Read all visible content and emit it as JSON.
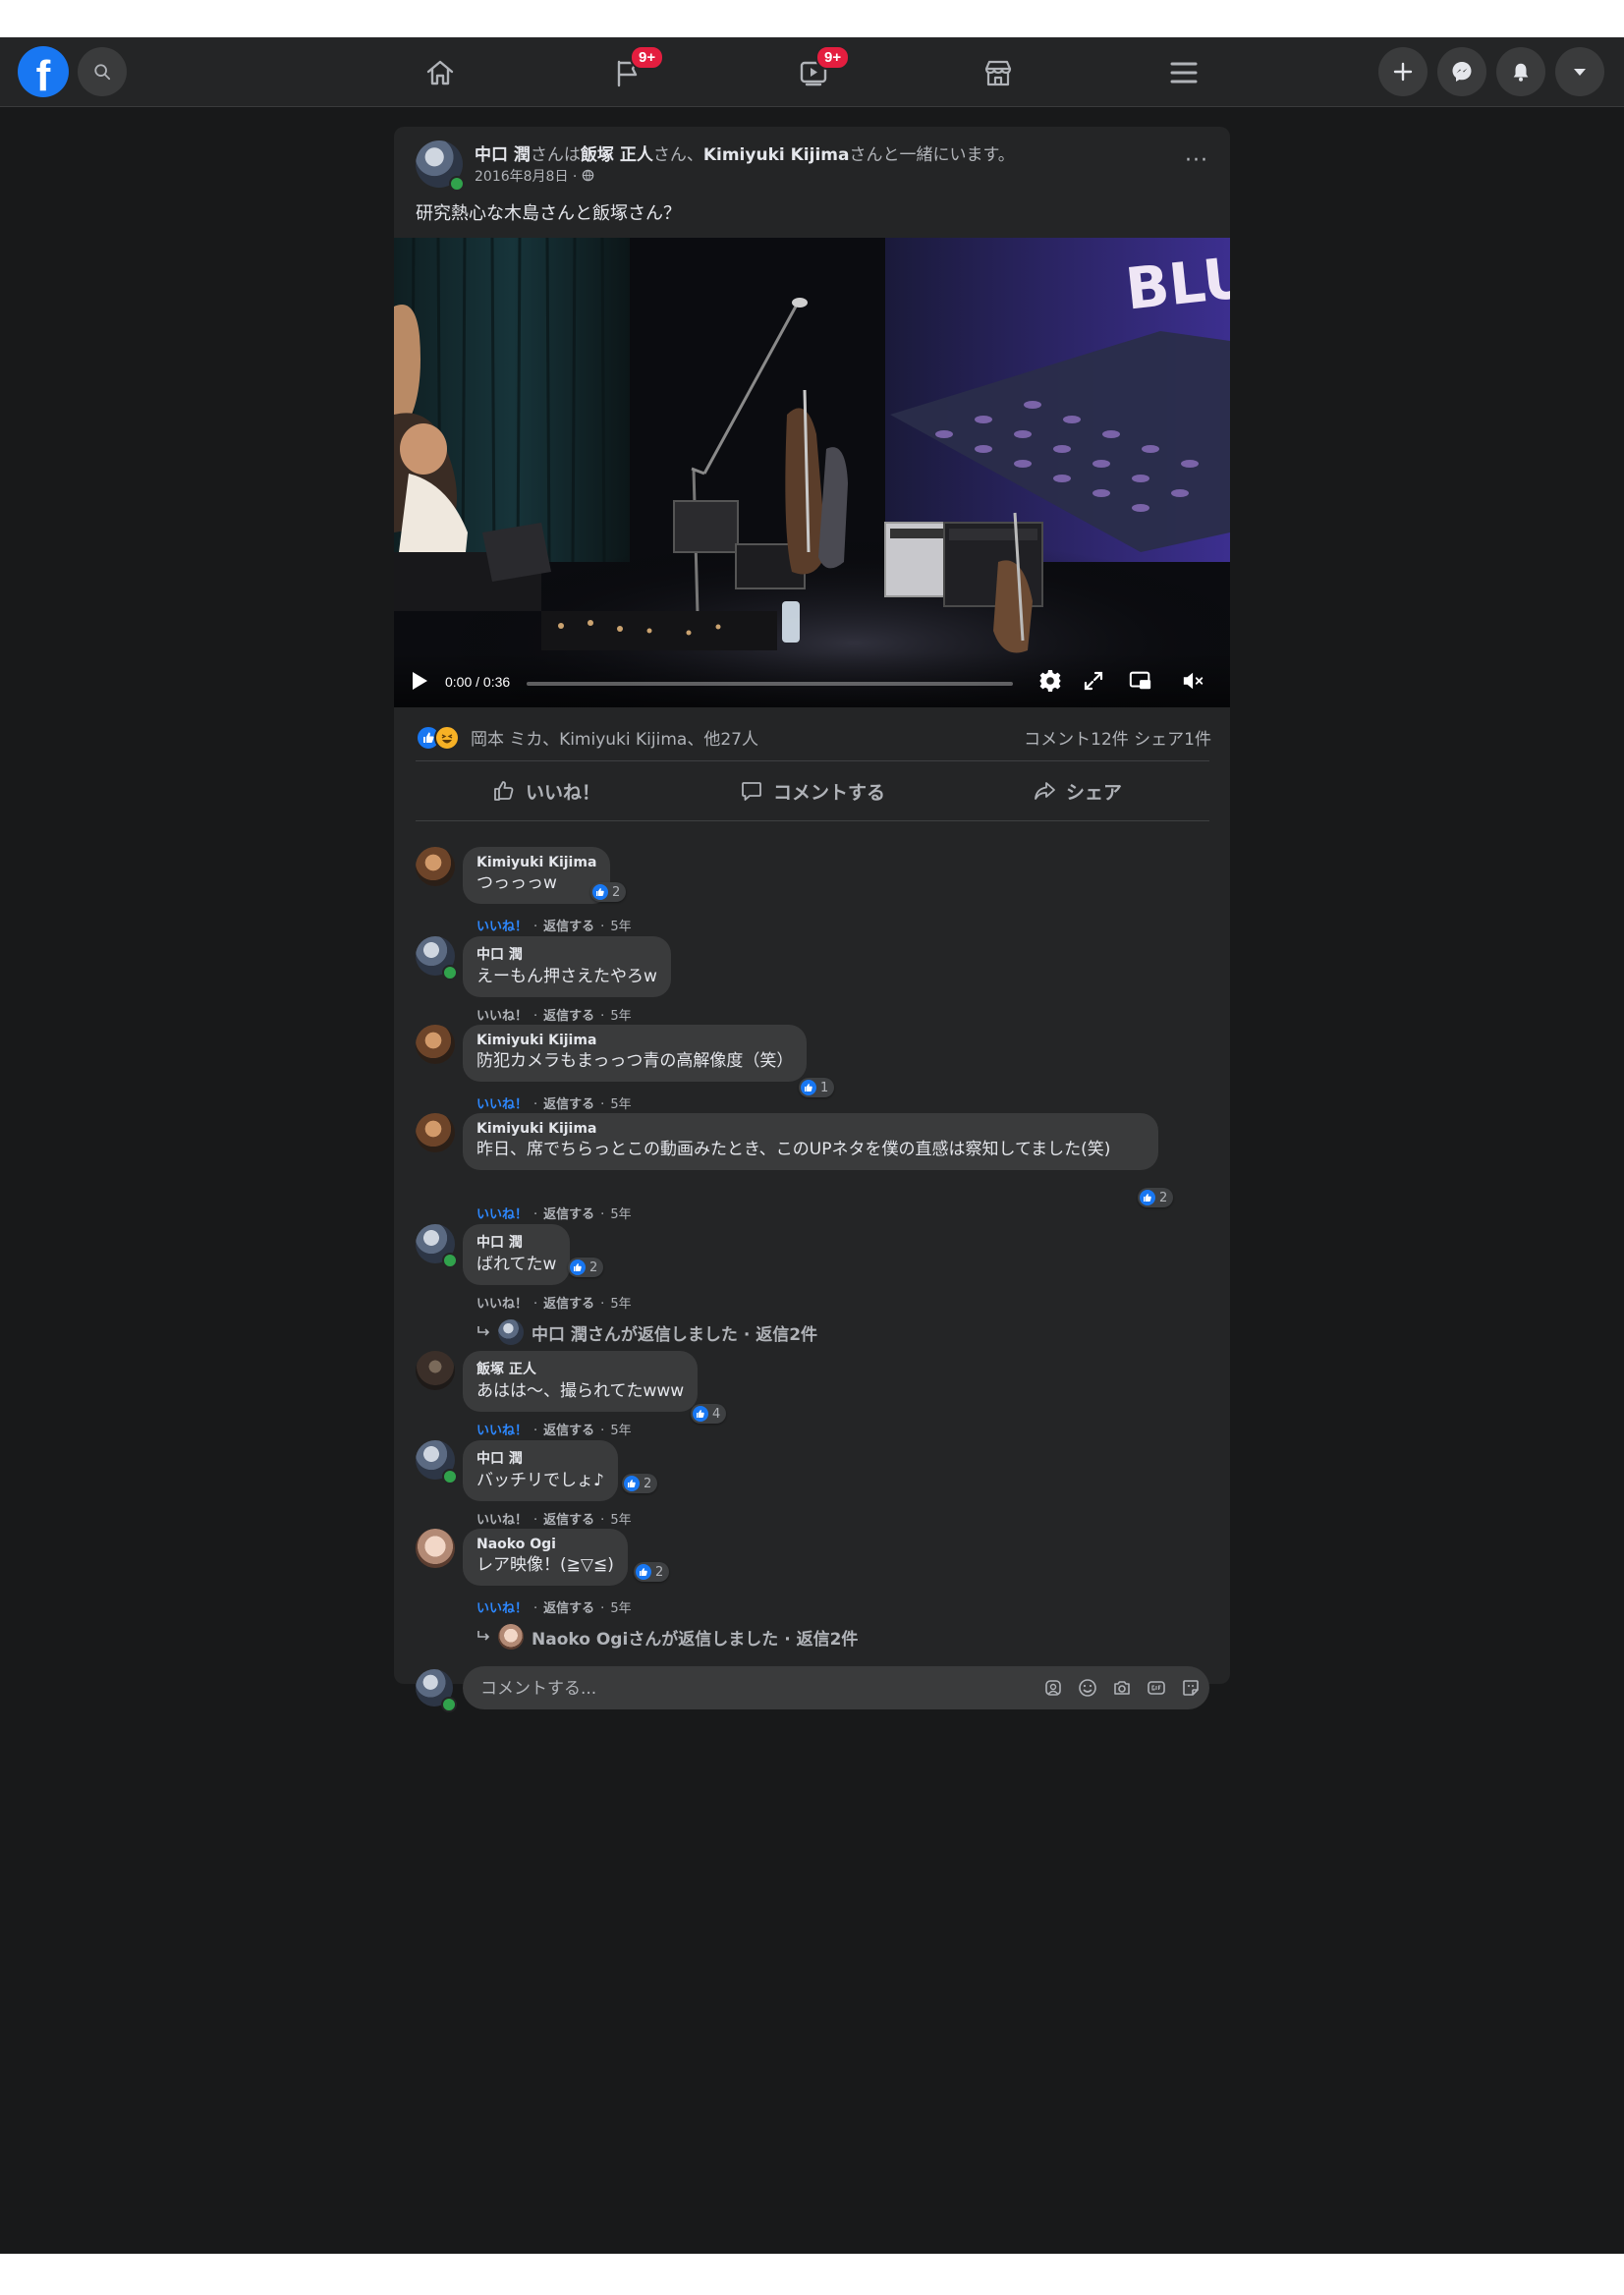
{
  "nav": {
    "logo_letter": "f",
    "pages_badge": "9+",
    "watch_badge": "9+"
  },
  "post": {
    "author": "中口 潤",
    "with_text_1": "さんは",
    "tag_1": "飯塚 正人",
    "with_text_2": "さん、",
    "tag_2": "Kimiyuki Kijima",
    "with_text_3": "さんと一緒にいます。",
    "date": "2016年8月8日 ·",
    "text": "研究熱心な木島さんと飯塚さん？",
    "more": "···"
  },
  "video": {
    "time": "0:00 / 0:36",
    "sign_text": "BLUE"
  },
  "reactions": {
    "names": "岡本 ミカ、Kimiyuki Kijima、他27人",
    "stats": "コメント12件 シェア1件"
  },
  "actions": {
    "like": "いいね！",
    "comment": "コメントする",
    "share": "シェア"
  },
  "comment_meta": {
    "like": "いいね！",
    "reply": "返信する",
    "sep": "·",
    "age": "5年"
  },
  "comments": [
    {
      "name": "Kimiyuki Kijima",
      "text": "つっっっw",
      "likes": "2",
      "liked": true
    },
    {
      "name": "中口 潤",
      "text": "えーもん押さえたやろw",
      "likes": "",
      "liked": false
    },
    {
      "name": "Kimiyuki Kijima",
      "text": "防犯カメラもまっっつ青の高解像度（笑）",
      "likes": "1",
      "liked": true
    },
    {
      "name": "Kimiyuki Kijima",
      "text": "昨日、席でちらっとこの動画みたとき、このUPネタを僕の直感は察知してました(笑)",
      "likes": "2",
      "liked": true
    },
    {
      "name": "中口 潤",
      "text": "ばれてたw",
      "likes": "2",
      "liked": false
    },
    {
      "name": "飯塚 正人",
      "text": "あはは〜、撮られてたwww",
      "likes": "4",
      "liked": true
    },
    {
      "name": "中口 潤",
      "text": "バッチリでしょ♪",
      "likes": "2",
      "liked": false
    },
    {
      "name": "Naoko Ogi",
      "text": "レア映像！(≧▽≦)",
      "likes": "2",
      "liked": true
    }
  ],
  "replies": {
    "reply_1": "中口 潤さんが返信しました · 返信2件",
    "reply_2": "Naoko Ogiさんが返信しました · 返信2件"
  },
  "composer": {
    "placeholder": "コメントする..."
  },
  "colors": {
    "background": "#18191a",
    "card": "#242526",
    "accent": "#1877f2",
    "badge": "#e41e3f",
    "online": "#31a24c"
  }
}
